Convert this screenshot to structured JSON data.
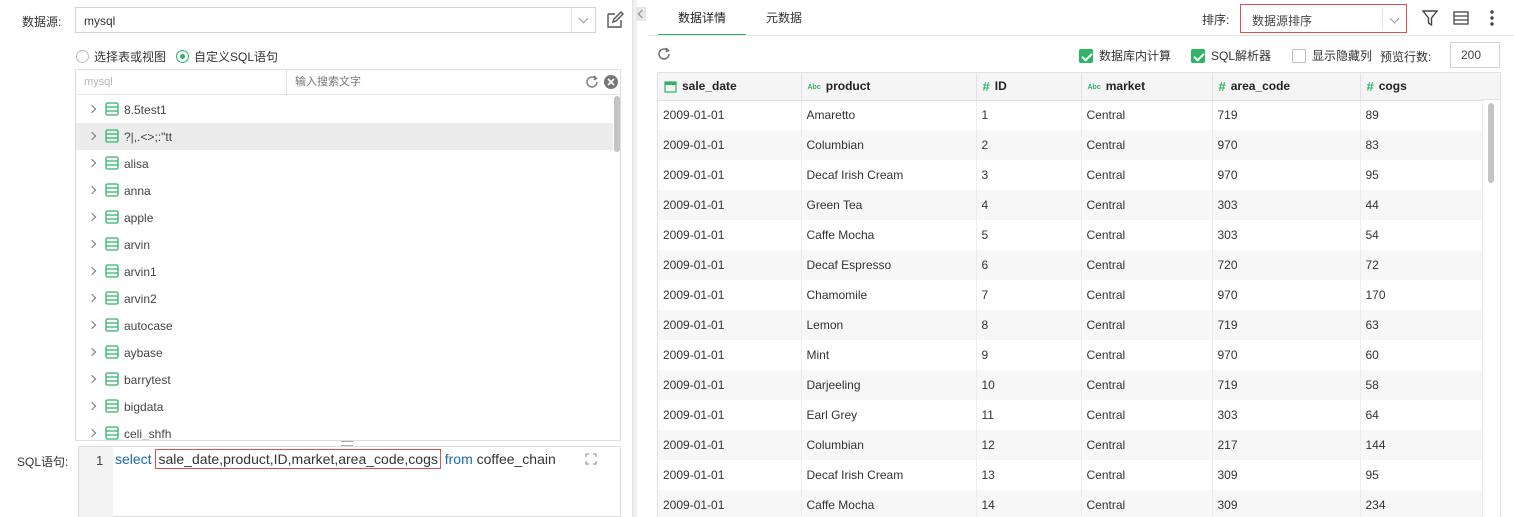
{
  "datasource": {
    "label": "数据源:",
    "value": "mysql"
  },
  "mode": {
    "option1": "选择表或视图",
    "option2": "自定义SQL语句",
    "selected": 2
  },
  "tree": {
    "db_name": "mysql",
    "search_placeholder": "输入搜索文字",
    "items": [
      {
        "label": "8.5test1"
      },
      {
        "label": "?|,.<>;:\"tt"
      },
      {
        "label": "alisa"
      },
      {
        "label": "anna"
      },
      {
        "label": "apple"
      },
      {
        "label": "arvin"
      },
      {
        "label": "arvin1"
      },
      {
        "label": "arvin2"
      },
      {
        "label": "autocase"
      },
      {
        "label": "aybase"
      },
      {
        "label": "barrytest"
      },
      {
        "label": "bigdata"
      },
      {
        "label": "celi_shfh"
      }
    ]
  },
  "sql": {
    "label": "SQL语句:",
    "line_no": "1",
    "kw_select": "select",
    "fields": "sale_date,product,ID,market,area_code,cogs",
    "kw_from": "from",
    "table": "coffee_chain"
  },
  "tabs": [
    {
      "label": "数据详情"
    },
    {
      "label": "元数据"
    }
  ],
  "sort": {
    "label": "排序:",
    "value": "数据源排序"
  },
  "options": {
    "db_compute": "数据库内计算",
    "sql_parser": "SQL解析器",
    "show_hidden": "显示隐藏列",
    "preview_label": "预览行数:",
    "preview_value": "200"
  },
  "columns": [
    {
      "name": "sale_date",
      "type": "date"
    },
    {
      "name": "product",
      "type": "text"
    },
    {
      "name": "ID",
      "type": "num"
    },
    {
      "name": "market",
      "type": "text"
    },
    {
      "name": "area_code",
      "type": "num"
    },
    {
      "name": "cogs",
      "type": "num"
    }
  ],
  "type_labels": {
    "num": "#",
    "text": "Abc"
  },
  "rows": [
    [
      "2009-01-01",
      "Amaretto",
      "1",
      "Central",
      "719",
      "89"
    ],
    [
      "2009-01-01",
      "Columbian",
      "2",
      "Central",
      "970",
      "83"
    ],
    [
      "2009-01-01",
      "Decaf Irish Cream",
      "3",
      "Central",
      "970",
      "95"
    ],
    [
      "2009-01-01",
      "Green Tea",
      "4",
      "Central",
      "303",
      "44"
    ],
    [
      "2009-01-01",
      "Caffe Mocha",
      "5",
      "Central",
      "303",
      "54"
    ],
    [
      "2009-01-01",
      "Decaf Espresso",
      "6",
      "Central",
      "720",
      "72"
    ],
    [
      "2009-01-01",
      "Chamomile",
      "7",
      "Central",
      "970",
      "170"
    ],
    [
      "2009-01-01",
      "Lemon",
      "8",
      "Central",
      "719",
      "63"
    ],
    [
      "2009-01-01",
      "Mint",
      "9",
      "Central",
      "970",
      "60"
    ],
    [
      "2009-01-01",
      "Darjeeling",
      "10",
      "Central",
      "719",
      "58"
    ],
    [
      "2009-01-01",
      "Earl Grey",
      "11",
      "Central",
      "303",
      "64"
    ],
    [
      "2009-01-01",
      "Columbian",
      "12",
      "Central",
      "217",
      "144"
    ],
    [
      "2009-01-01",
      "Decaf Irish Cream",
      "13",
      "Central",
      "309",
      "95"
    ],
    [
      "2009-01-01",
      "Caffe Mocha",
      "14",
      "Central",
      "309",
      "234"
    ]
  ],
  "colors": {
    "accent": "#2db56a",
    "highlight": "#d9534f",
    "keyword": "#1d68a8"
  }
}
